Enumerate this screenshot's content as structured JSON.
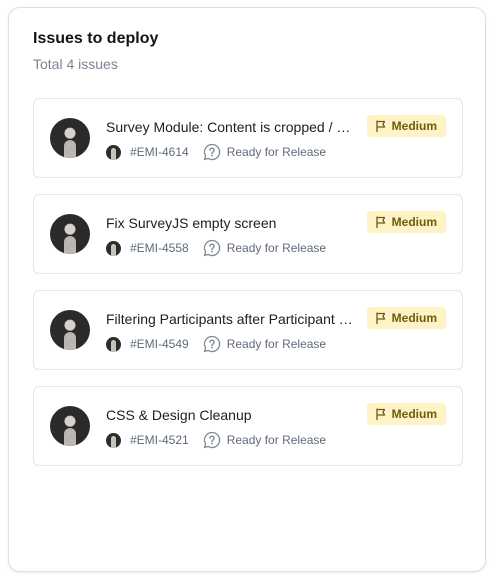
{
  "header": {
    "title": "Issues to deploy",
    "subtitle": "Total 4 issues"
  },
  "issues": [
    {
      "title": "Survey Module: Content is cropped / …",
      "key": "#EMI-4614",
      "status": "Ready for Release",
      "priority": "Medium"
    },
    {
      "title": "Fix SurveyJS empty screen",
      "key": "#EMI-4558",
      "status": "Ready for Release",
      "priority": "Medium"
    },
    {
      "title": "Filtering Participants after Participant …",
      "key": "#EMI-4549",
      "status": "Ready for Release",
      "priority": "Medium"
    },
    {
      "title": "CSS & Design Cleanup",
      "key": "#EMI-4521",
      "status": "Ready for Release",
      "priority": "Medium"
    }
  ],
  "icons": {
    "status": "question-bubble-icon",
    "priority": "flag-icon"
  },
  "colors": {
    "priority_bg": "#fdf3c4",
    "priority_text": "#6b5a12"
  }
}
